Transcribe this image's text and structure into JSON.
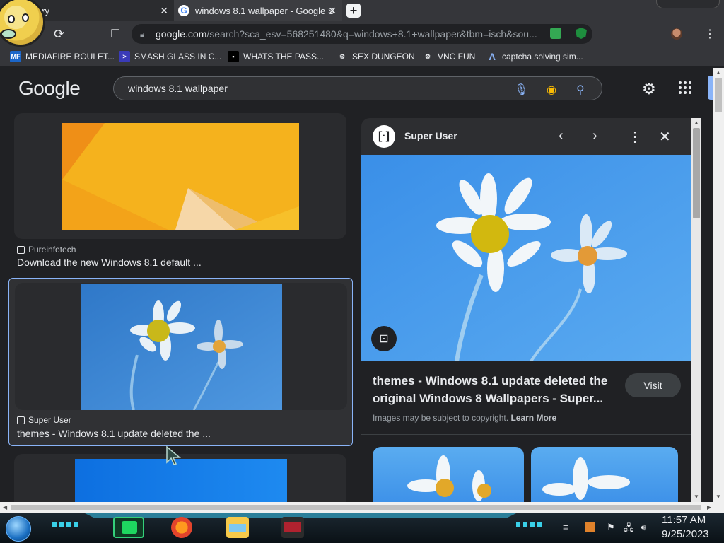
{
  "browser": {
    "tabs": [
      {
        "label": "ory",
        "active": false
      },
      {
        "label": "windows 8.1 wallpaper - Google S",
        "active": true
      }
    ],
    "new_tab": "+",
    "tab_close": "✕",
    "url_host": "google.com",
    "url_rest": "/search?sca_esv=568251480&q=windows+8.1+wallpaper&tbm=isch&sou...",
    "bookmarks": [
      {
        "label": "MEDIAFIRE ROULET...",
        "icon": "mediafire-icon"
      },
      {
        "label": "SMASH GLASS IN C...",
        "icon": "smash-icon"
      },
      {
        "label": "WHATS THE PASS...",
        "icon": "pass-icon"
      },
      {
        "label": "SEX DUNGEON",
        "icon": "dungeon-icon"
      },
      {
        "label": "VNC FUN",
        "icon": "vnc-icon"
      },
      {
        "label": "captcha solving sim...",
        "icon": "captcha-icon"
      }
    ]
  },
  "google": {
    "logo": "Google",
    "query": "windows 8.1 wallpaper"
  },
  "results": [
    {
      "source": "Pureinfotech",
      "title": "Download the new Windows 8.1 default ..."
    },
    {
      "source": "Super User",
      "title": "themes - Windows 8.1 update deleted the ..."
    }
  ],
  "preview": {
    "site": "Super User",
    "title": "themes - Windows 8.1 update deleted the original Windows 8 Wallpapers - Super...",
    "visit": "Visit",
    "copyright": "Images may be subject to copyright.",
    "learn_more": "Learn More"
  },
  "taskbar": {
    "time": "11:57 AM",
    "date": "9/25/2023"
  },
  "colors": {
    "wallpaper_yellow": "#f5b21d",
    "wallpaper_blue": "#3b8ee6",
    "accent_blue": "#8ab4f8"
  }
}
